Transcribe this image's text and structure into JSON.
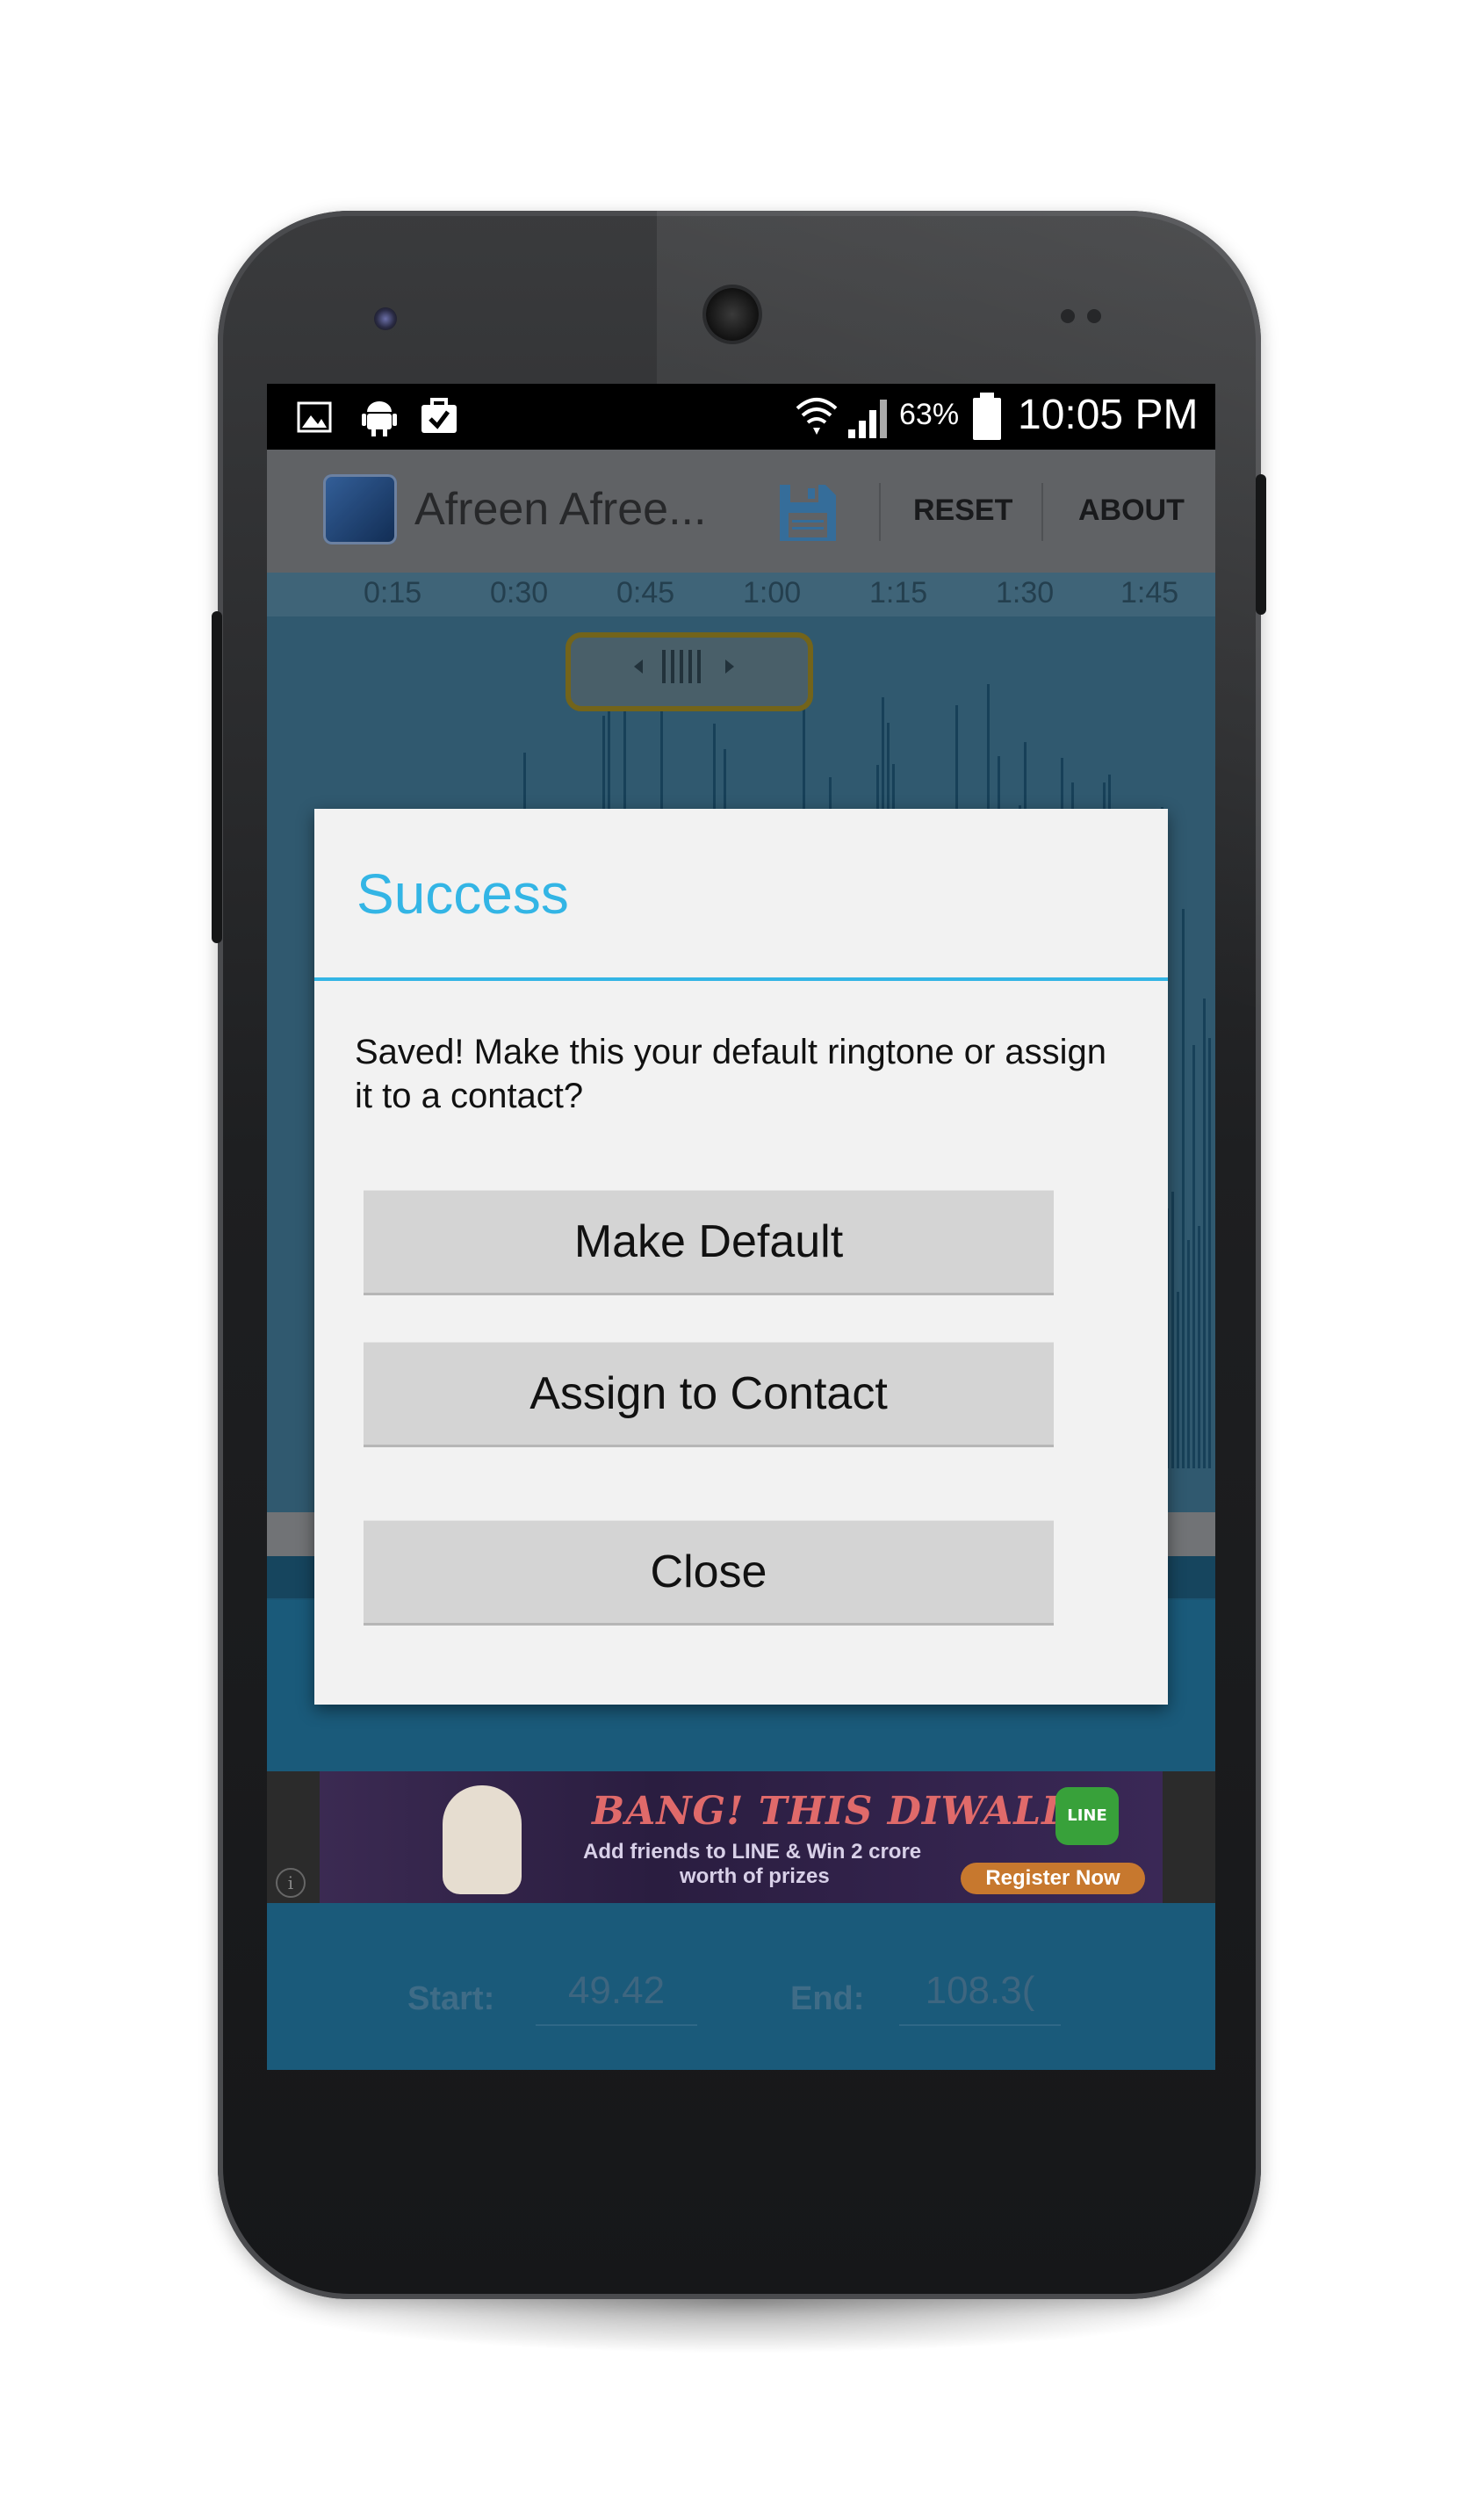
{
  "status_bar": {
    "battery_percent": "63%",
    "time": "10:05 PM",
    "left_icons": [
      "image-icon",
      "android-icon",
      "shopping-bag-check-icon"
    ],
    "right_icons": [
      "wifi-icon",
      "cell-signal-icon",
      "battery-icon"
    ]
  },
  "action_bar": {
    "app_title": "Afreen Afree...",
    "reset_label": "RESET",
    "about_label": "ABOUT"
  },
  "timeline": {
    "ticks": [
      "0:15",
      "0:30",
      "0:45",
      "1:00",
      "1:15",
      "1:30",
      "1:45"
    ]
  },
  "dialog": {
    "title": "Success",
    "message": "Saved! Make this your default ringtone or assign it to a contact?",
    "buttons": {
      "make_default": "Make Default",
      "assign_contact": "Assign to Contact",
      "close": "Close"
    }
  },
  "ad": {
    "headline": "BANG! THIS DIWALI",
    "subtext_line1": "Add friends to LINE & Win 2 crore",
    "subtext_line2": "worth of prizes",
    "logo_text": "LINE",
    "cta": "Register Now",
    "info": "i"
  },
  "bottom": {
    "start_label": "Start:",
    "start_value": "49.42",
    "end_label": "End:",
    "end_value": "108.3("
  },
  "colors": {
    "accent": "#33b5e5",
    "dialog_bg": "#f2f2f2",
    "button_bg": "#d4d4d4",
    "action_bar": "#6e7073"
  }
}
